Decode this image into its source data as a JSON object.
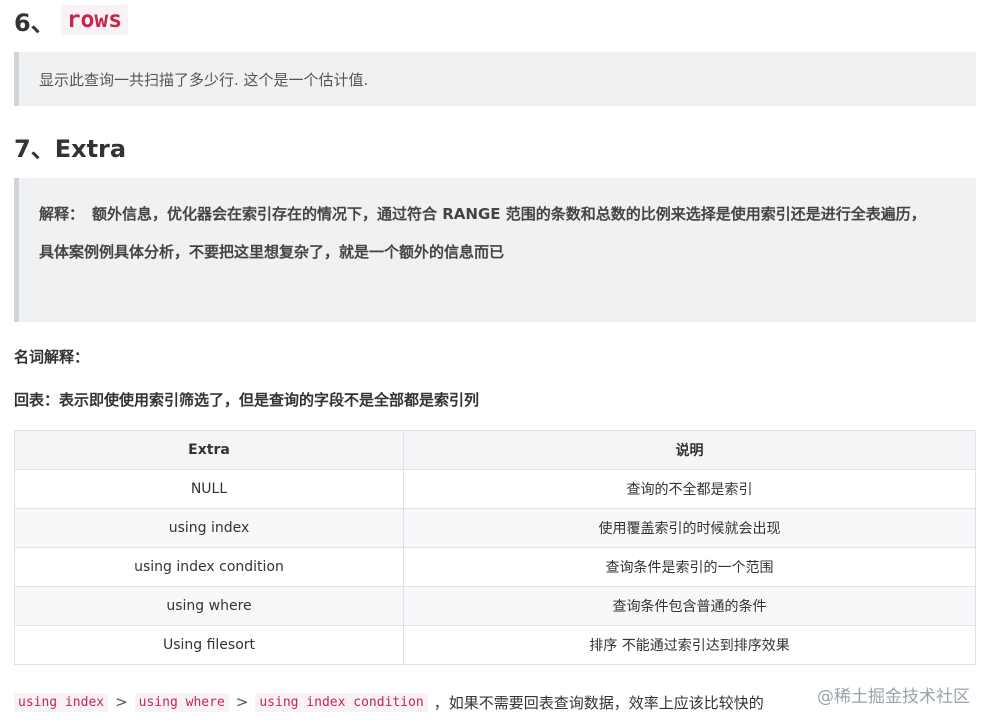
{
  "section6": {
    "number": "6、",
    "keyword": "rows",
    "quote": "显示此查询一共扫描了多少行. 这个是一个估计值."
  },
  "section7": {
    "title": "7、Extra",
    "quote_label": "解释：",
    "quote_line1": "额外信息，优化器会在索引存在的情况下，通过符合 RANGE 范围的条数和总数的比例来选择是使用索引还是进行全表遍历，",
    "quote_line2": "具体案例例具体分析，不要把这里想复杂了，就是一个额外的信息而已"
  },
  "terms_title": "名词解释：",
  "huibiao": "回表：表示即使使用索引筛选了，但是查询的字段不是全部都是索引列",
  "table": {
    "headers": [
      "Extra",
      "说明"
    ],
    "rows": [
      [
        "NULL",
        "查询的不全都是索引"
      ],
      [
        "using index",
        "使用覆盖索引的时候就会出现"
      ],
      [
        "using index condition",
        "查询条件是索引的一个范围"
      ],
      [
        "using where",
        "查询条件包含普通的条件"
      ],
      [
        "Using filesort",
        "排序 不能通过索引达到排序效果"
      ]
    ]
  },
  "footer": {
    "code1": "using index",
    "sep1": ">",
    "code2": "using where",
    "sep2": ">",
    "code3": "using index condition",
    "text": "，如果不需要回表查询数据，效率上应该比较快的"
  },
  "watermark": "@稀土掘金技术社区"
}
